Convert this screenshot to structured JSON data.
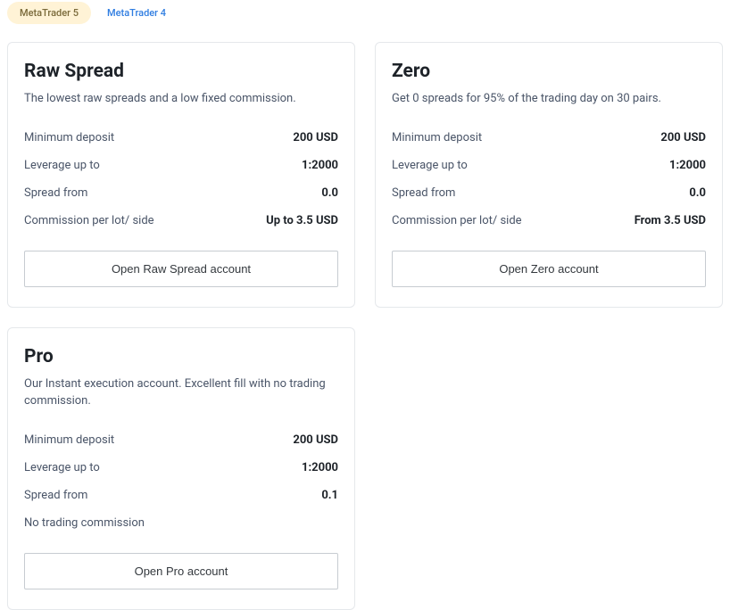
{
  "tabs": {
    "mt5": "MetaTrader 5",
    "mt4": "MetaTrader 4"
  },
  "cards": {
    "rawSpread": {
      "title": "Raw Spread",
      "desc": "The lowest raw spreads and a low fixed commission.",
      "rows": {
        "minDeposit": {
          "label": "Minimum deposit",
          "value": "200 USD"
        },
        "leverage": {
          "label": "Leverage up to",
          "value": "1:2000"
        },
        "spread": {
          "label": "Spread from",
          "value": "0.0"
        },
        "commission": {
          "label": "Commission per lot/ side",
          "value": "Up to 3.5 USD"
        }
      },
      "button": "Open Raw Spread account"
    },
    "zero": {
      "title": "Zero",
      "desc": "Get 0 spreads for 95% of the trading day on 30 pairs.",
      "rows": {
        "minDeposit": {
          "label": "Minimum deposit",
          "value": "200 USD"
        },
        "leverage": {
          "label": "Leverage up to",
          "value": "1:2000"
        },
        "spread": {
          "label": "Spread from",
          "value": "0.0"
        },
        "commission": {
          "label": "Commission per lot/ side",
          "value": "From 3.5 USD"
        }
      },
      "button": "Open Zero account"
    },
    "pro": {
      "title": "Pro",
      "desc": "Our Instant execution account. Excellent fill with no trading commission.",
      "rows": {
        "minDeposit": {
          "label": "Minimum deposit",
          "value": "200 USD"
        },
        "leverage": {
          "label": "Leverage up to",
          "value": "1:2000"
        },
        "spread": {
          "label": "Spread from",
          "value": "0.1"
        }
      },
      "commissionNote": "No trading commission",
      "button": "Open Pro account"
    }
  }
}
